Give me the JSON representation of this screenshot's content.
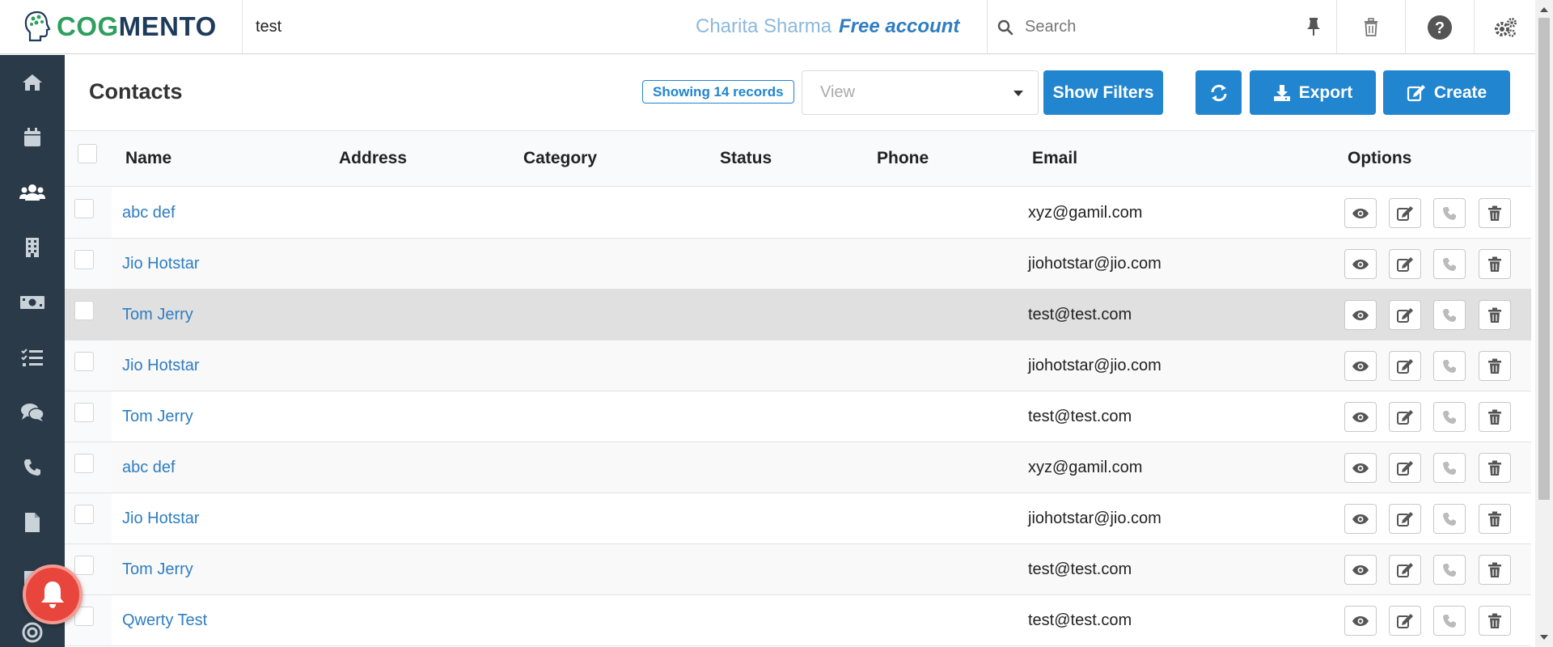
{
  "app": {
    "logo_text_cog": "COG",
    "logo_text_mento": "MENTO",
    "project_name": "test",
    "user_name": "Charita Sharma",
    "plan": "Free account",
    "search_placeholder": "Search"
  },
  "page": {
    "title": "Contacts",
    "records_badge": "Showing 14 records",
    "view_placeholder": "View",
    "buttons": {
      "show_filters": "Show Filters",
      "export": "Export",
      "create": "Create"
    }
  },
  "table": {
    "columns": [
      "Name",
      "Address",
      "Category",
      "Status",
      "Phone",
      "Email",
      "Options"
    ],
    "rows": [
      {
        "name": "abc def",
        "email": "xyz@gamil.com"
      },
      {
        "name": "Jio Hotstar",
        "email": "jiohotstar@jio.com"
      },
      {
        "name": "Tom Jerry",
        "email": "test@test.com"
      },
      {
        "name": "Jio Hotstar",
        "email": "jiohotstar@jio.com"
      },
      {
        "name": "Tom Jerry",
        "email": "test@test.com"
      },
      {
        "name": "abc def",
        "email": "xyz@gamil.com"
      },
      {
        "name": "Jio Hotstar",
        "email": "jiohotstar@jio.com"
      },
      {
        "name": "Tom Jerry",
        "email": "test@test.com"
      },
      {
        "name": "Qwerty Test",
        "email": "test@test.com"
      }
    ],
    "row_options": [
      "view-icon",
      "edit-icon",
      "call-icon",
      "delete-icon"
    ]
  },
  "sidebar": {
    "items": [
      "home-icon",
      "calendar-icon",
      "contacts-icon",
      "companies-icon",
      "deals-icon",
      "tasks-icon",
      "cases-icon",
      "calls-icon",
      "documents-icon",
      "email-icon",
      "campaigns-icon"
    ]
  },
  "colors": {
    "primary": "#2185d0",
    "sidebar": "#2b3a48",
    "link": "#2f7dc1",
    "bell": "#e8453c"
  }
}
